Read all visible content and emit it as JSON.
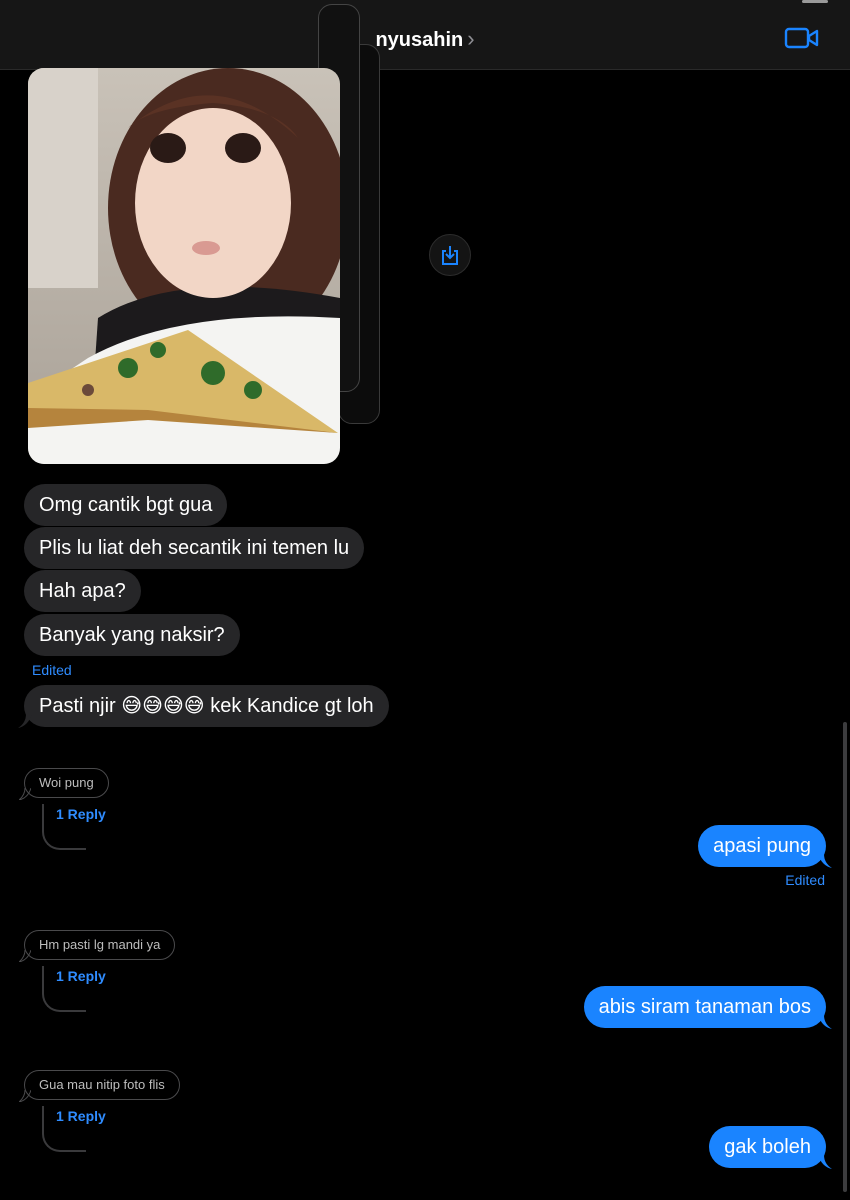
{
  "header": {
    "contact_name": "nyusahin",
    "chevron": "›",
    "video_icon": "video-camera-icon"
  },
  "photo": {
    "alt_icon": "photo-thumbnail",
    "save_icon": "save-download-icon"
  },
  "incoming": [
    {
      "text": "Omg cantik bgt gua"
    },
    {
      "text": "Plis lu liat deh secantik ini temen lu"
    },
    {
      "text": "Hah apa?"
    },
    {
      "text": "Banyak yang naksir?"
    },
    {
      "text": "Pasti njir 😅😅😅😅 kek Kandice gt loh"
    }
  ],
  "edited_left": "Edited",
  "threads": [
    {
      "quote": "Woi pung",
      "reply": "1 Reply",
      "answer": "apasi pung"
    },
    {
      "quote": "Hm pasti lg mandi ya",
      "reply": "1 Reply",
      "answer": "abis siram tanaman bos"
    },
    {
      "quote": "Gua mau nitip foto flis",
      "reply": "1 Reply",
      "answer": "gak boleh"
    }
  ],
  "edited_right": "Edited",
  "colors": {
    "outgoing": "#1a84ff",
    "incoming": "#262628",
    "accent": "#2f8cff"
  }
}
